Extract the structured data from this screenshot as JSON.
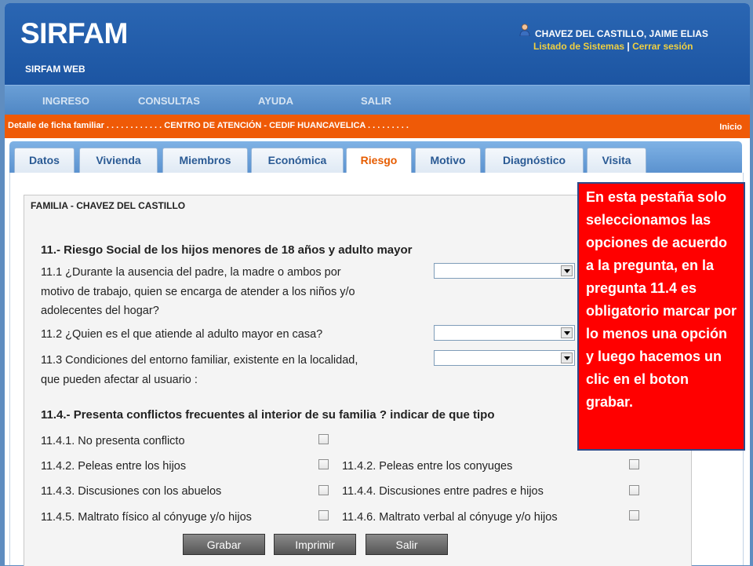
{
  "header": {
    "logo": "SIRFAM",
    "subtitle": "SIRFAM WEB",
    "user_name": "CHAVEZ DEL CASTILLO, JAIME ELIAS",
    "link_systems": "Listado de Sistemas",
    "link_separator": "|",
    "link_logout": "Cerrar sesión"
  },
  "nav": [
    "INGRESO",
    "CONSULTAS",
    "AYUDA",
    "SALIR"
  ],
  "breadcrumb": {
    "text": "Detalle de ficha familiar . . . . . . . . . . . . CENTRO DE ATENCIÓN - CEDIF HUANCAVELICA . . . . . . . . .",
    "home": "Inicio"
  },
  "tabs": [
    "Datos",
    "Vivienda",
    "Miembros",
    "Económica",
    "Riesgo",
    "Motivo",
    "Diagnóstico",
    "Visita"
  ],
  "active_tab": "Riesgo",
  "form": {
    "family": "FAMILIA - CHAVEZ DEL CASTILLO",
    "section11": "11.- Riesgo Social de los hijos menores de 18 años y adulto mayor",
    "q11_1": [
      "11.1 ¿Durante la ausencia del padre, la madre o ambos por",
      "motivo de trabajo, quien se encarga de atender a los niños y/o",
      "adolecentes del hogar?"
    ],
    "q11_2": "11.2 ¿Quien es el que atiende al adulto mayor en casa?",
    "q11_3": [
      "11.3 Condiciones del entorno familiar, existente en la localidad,",
      "que pueden afectar al usuario :"
    ],
    "section11_4": "11.4.- Presenta conflictos frecuentes al interior de su familia ? indicar de que tipo",
    "options_left": [
      "11.4.1. No presenta conflicto",
      "11.4.2. Peleas entre los hijos",
      "11.4.3. Discusiones con los abuelos",
      "11.4.5. Maltrato físico al cónyuge y/o hijos"
    ],
    "options_right": [
      "11.4.2. Peleas entre los conyuges",
      "11.4.4. Discusiones entre padres e hijos",
      "11.4.6. Maltrato verbal al cónyuge y/o hijos"
    ]
  },
  "buttons": {
    "save": "Grabar",
    "print": "Imprimir",
    "exit": "Salir"
  },
  "callout": "En esta pestaña solo seleccionamos las opciones de acuerdo a la pregunta, en la pregunta 11.4 es obligatorio marcar por lo menos una opción y luego hacemos un clic en el boton grabar.",
  "colors": {
    "header": "#1c55a2",
    "breadcrumb_bar": "#ef5a07",
    "active_tab_text": "#e65c00",
    "link": "#f0d040",
    "callout_bg": "#ff0000"
  }
}
